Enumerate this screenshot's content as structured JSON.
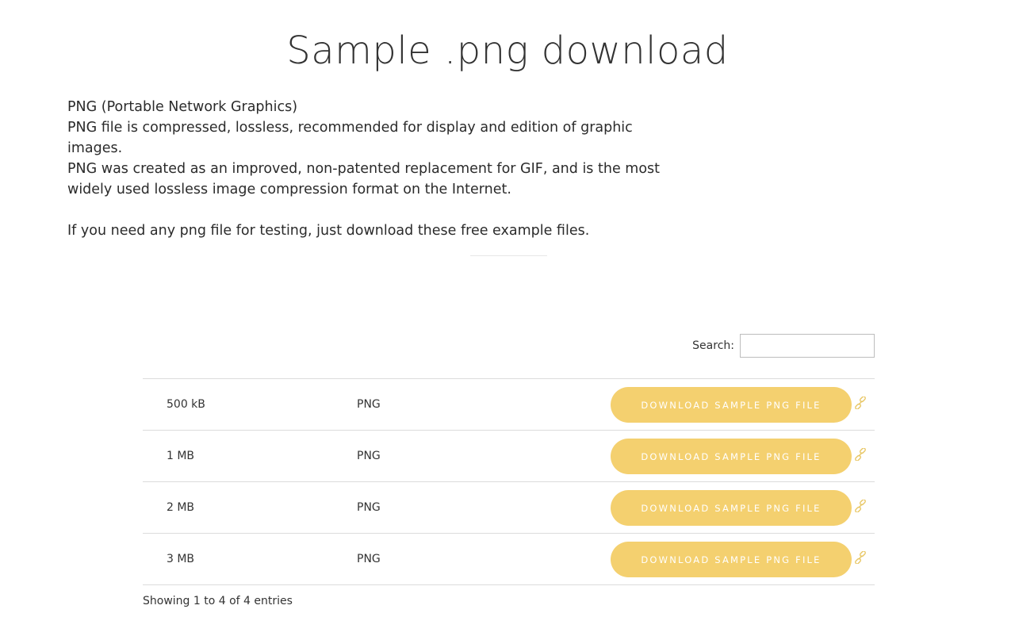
{
  "page": {
    "title": "Sample .png download"
  },
  "intro": {
    "lines": [
      "PNG (Portable Network Graphics)",
      "PNG file is compressed, lossless, recommended for display and edition of graphic images.",
      "PNG was created as an improved, non-patented replacement for GIF, and is the most",
      "widely used lossless image compression format on the Internet."
    ],
    "cta": "If you need any png file for testing, just download these free example files."
  },
  "search": {
    "label": "Search:",
    "value": "",
    "placeholder": ""
  },
  "table": {
    "rows": [
      {
        "size": "500 kB",
        "type": "PNG",
        "button": "Download sample png file",
        "link_icon": "link-icon"
      },
      {
        "size": "1 MB",
        "type": "PNG",
        "button": "Download sample png file",
        "link_icon": "link-icon"
      },
      {
        "size": "2 MB",
        "type": "PNG",
        "button": "Download sample png file",
        "link_icon": "link-icon"
      },
      {
        "size": "3 MB",
        "type": "PNG",
        "button": "Download sample png file",
        "link_icon": "link-icon"
      }
    ],
    "summary": "Showing 1 to 4 of 4 entries"
  },
  "colors": {
    "button_bg": "#f4d06f",
    "button_text": "#ffffff",
    "link_icon": "#e8c766",
    "divider": "#dcdcdc"
  }
}
